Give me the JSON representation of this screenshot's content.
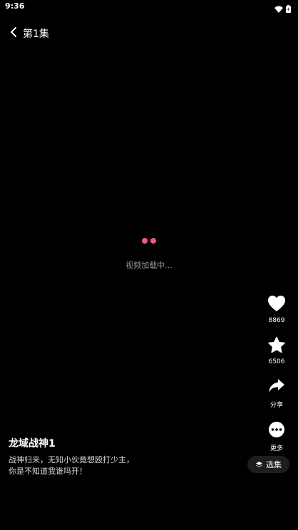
{
  "status_bar": {
    "time": "9:36",
    "icons": [
      "wifi-icon",
      "battery-icon"
    ]
  },
  "header": {
    "back_icon": "chevron-left-icon",
    "episode_title": "第1集"
  },
  "player": {
    "loading_text": "视频加载中...",
    "accent_color": "#f25a84"
  },
  "actions": {
    "like": {
      "icon": "heart-icon",
      "count": "8869"
    },
    "favorite": {
      "icon": "star-icon",
      "count": "6506"
    },
    "share": {
      "icon": "share-icon",
      "label": "分享"
    },
    "more": {
      "icon": "more-icon",
      "label": "更多"
    }
  },
  "drama": {
    "title": "龙域战神1",
    "description": "战神归来，无知小伙竟想殴打少主，\n你是不知道我谁吗开！"
  },
  "episodes_button": {
    "icon": "layers-icon",
    "label": "选集"
  }
}
